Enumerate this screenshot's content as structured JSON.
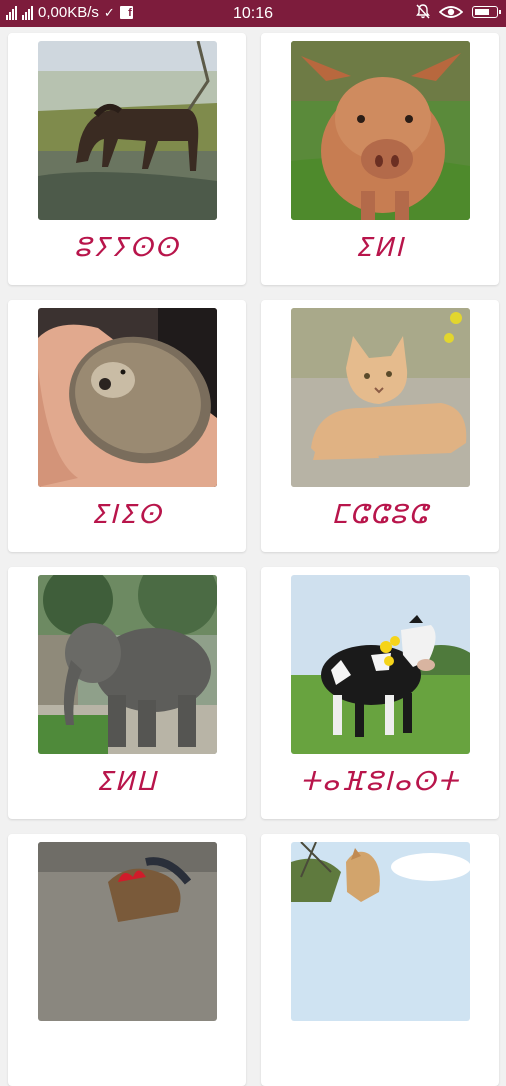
{
  "status_bar": {
    "data_rate": "0,00KB/s",
    "time": "10:16",
    "battery_level": 0.75,
    "colors": {
      "bar": "#7d1c3c"
    },
    "icons": [
      "signal-icon",
      "check-icon",
      "facebook-icon",
      "notification-off-icon",
      "eye-icon",
      "battery-icon"
    ]
  },
  "colors": {
    "label": "#b8154b",
    "background": "#f1f1f1",
    "card": "#ffffff"
  },
  "animals": [
    {
      "label": "ⵓⵢⵢⵙⵙ",
      "image": "horse"
    },
    {
      "label": "ⵉⵍⵏ",
      "image": "pig"
    },
    {
      "label": "ⵉⵏⵉⵙ",
      "image": "hedgehog"
    },
    {
      "label": "ⵎⵛⵛⵓⵛ",
      "image": "cat"
    },
    {
      "label": "ⵉⵍⵡ",
      "image": "elephant"
    },
    {
      "label": "ⵜⴰⴼⵓⵏⴰⵙⵜ",
      "image": "cow"
    },
    {
      "label": "",
      "image": "rooster"
    },
    {
      "label": "",
      "image": "camel"
    }
  ]
}
